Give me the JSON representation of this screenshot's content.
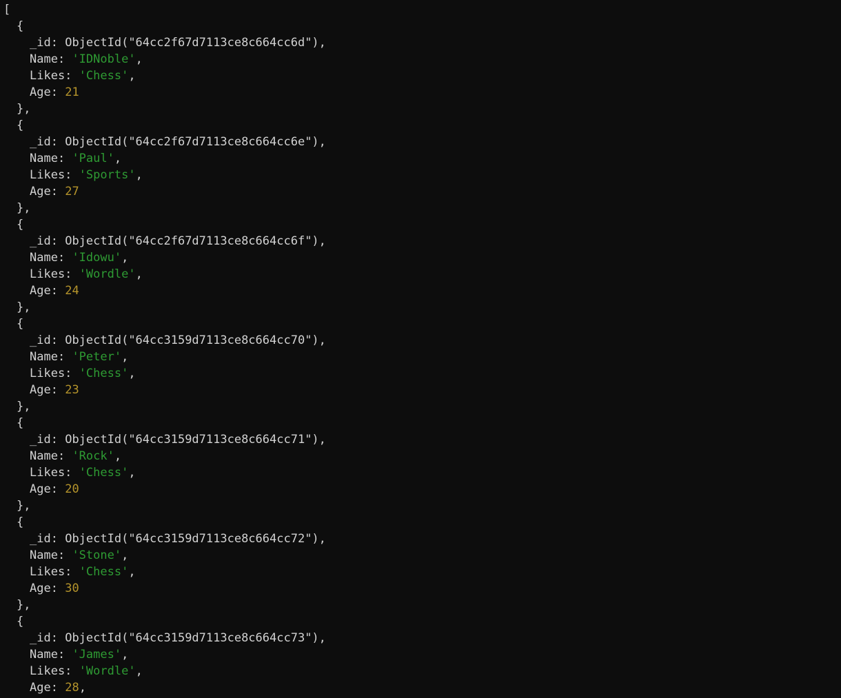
{
  "terminal": {
    "background_color": "#0d0d0d",
    "colors": {
      "default_text": "#d2d2d2",
      "string": "#2e9b33",
      "number": "#b5942b"
    },
    "open_bracket": "[",
    "object_open": "{",
    "object_close": "},",
    "keys": {
      "id": "_id:",
      "name": "Name:",
      "likes": "Likes:",
      "age": "Age:"
    },
    "comma": ","
  },
  "documents": [
    {
      "id_expression": "ObjectId(\"64cc2f67d7113ce8c664cc6d\"),",
      "name_value": "'IDNoble'",
      "likes_value": "'Chess'",
      "age_value": "21",
      "age_trailing": ""
    },
    {
      "id_expression": "ObjectId(\"64cc2f67d7113ce8c664cc6e\"),",
      "name_value": "'Paul'",
      "likes_value": "'Sports'",
      "age_value": "27",
      "age_trailing": ""
    },
    {
      "id_expression": "ObjectId(\"64cc2f67d7113ce8c664cc6f\"),",
      "name_value": "'Idowu'",
      "likes_value": "'Wordle'",
      "age_value": "24",
      "age_trailing": ""
    },
    {
      "id_expression": "ObjectId(\"64cc3159d7113ce8c664cc70\"),",
      "name_value": "'Peter'",
      "likes_value": "'Chess'",
      "age_value": "23",
      "age_trailing": ""
    },
    {
      "id_expression": "ObjectId(\"64cc3159d7113ce8c664cc71\"),",
      "name_value": "'Rock'",
      "likes_value": "'Chess'",
      "age_value": "20",
      "age_trailing": ""
    },
    {
      "id_expression": "ObjectId(\"64cc3159d7113ce8c664cc72\"),",
      "name_value": "'Stone'",
      "likes_value": "'Chess'",
      "age_value": "30",
      "age_trailing": ""
    },
    {
      "id_expression": "ObjectId(\"64cc3159d7113ce8c664cc73\"),",
      "name_value": "'James'",
      "likes_value": "'Wordle'",
      "age_value": "28",
      "age_trailing": ",",
      "clipped": true
    }
  ]
}
